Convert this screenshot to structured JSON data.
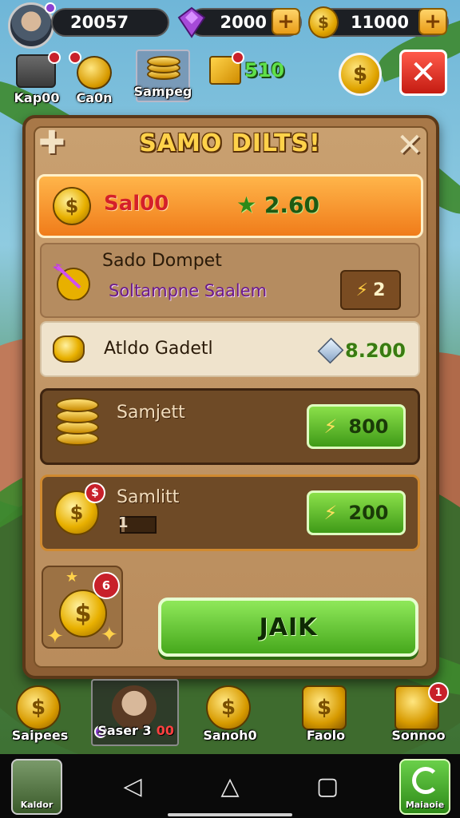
{
  "top_bar": {
    "score": "20057",
    "gems": "2000",
    "coins": "11000",
    "plus_label": "+",
    "coin_symbol": "$"
  },
  "shortcuts": {
    "items": [
      {
        "label": "Kap00",
        "icon": "chest-icon"
      },
      {
        "label": "Ca0n",
        "icon": "coin-bag-icon"
      },
      {
        "label": "Sampeg",
        "icon": "coin-stack-icon"
      }
    ],
    "box_count": "510",
    "badge": "1"
  },
  "panel": {
    "title": "SAMO DILTS!",
    "close_label": "✕",
    "offer": {
      "label": "Sal00",
      "value": "2.60",
      "coin_symbol": "$"
    },
    "item1": {
      "title": "Sado Dompet",
      "subtitle": "Soltampne Saalem",
      "badge_value": "2"
    },
    "item2": {
      "label": "Atldo Gadetl",
      "value": "8.200"
    },
    "item3": {
      "label": "Samjett",
      "price": "800"
    },
    "item4": {
      "label": "Samlitt",
      "price": "200",
      "progress_text": "1",
      "progress": 0.1
    },
    "bonus_badge": "6",
    "join_label": "JAIK"
  },
  "dock": {
    "items": [
      {
        "label": "Saipees"
      },
      {
        "label": "Saser 3",
        "badge": "00"
      },
      {
        "label": "Sanoh0"
      },
      {
        "label": "Faolo"
      },
      {
        "label": "Sonnoo",
        "badge": "1"
      }
    ]
  },
  "nav": {
    "back_icon": "◁",
    "home_icon": "△",
    "recents_icon": "▢",
    "left_app_label": "Kaldor",
    "right_app_label": "Maiaoie"
  },
  "colors": {
    "accent_orange": "#f07c1a",
    "accent_green": "#46a81c",
    "title_gold": "#ffd24a",
    "panel_brown": "#8c5e34"
  }
}
